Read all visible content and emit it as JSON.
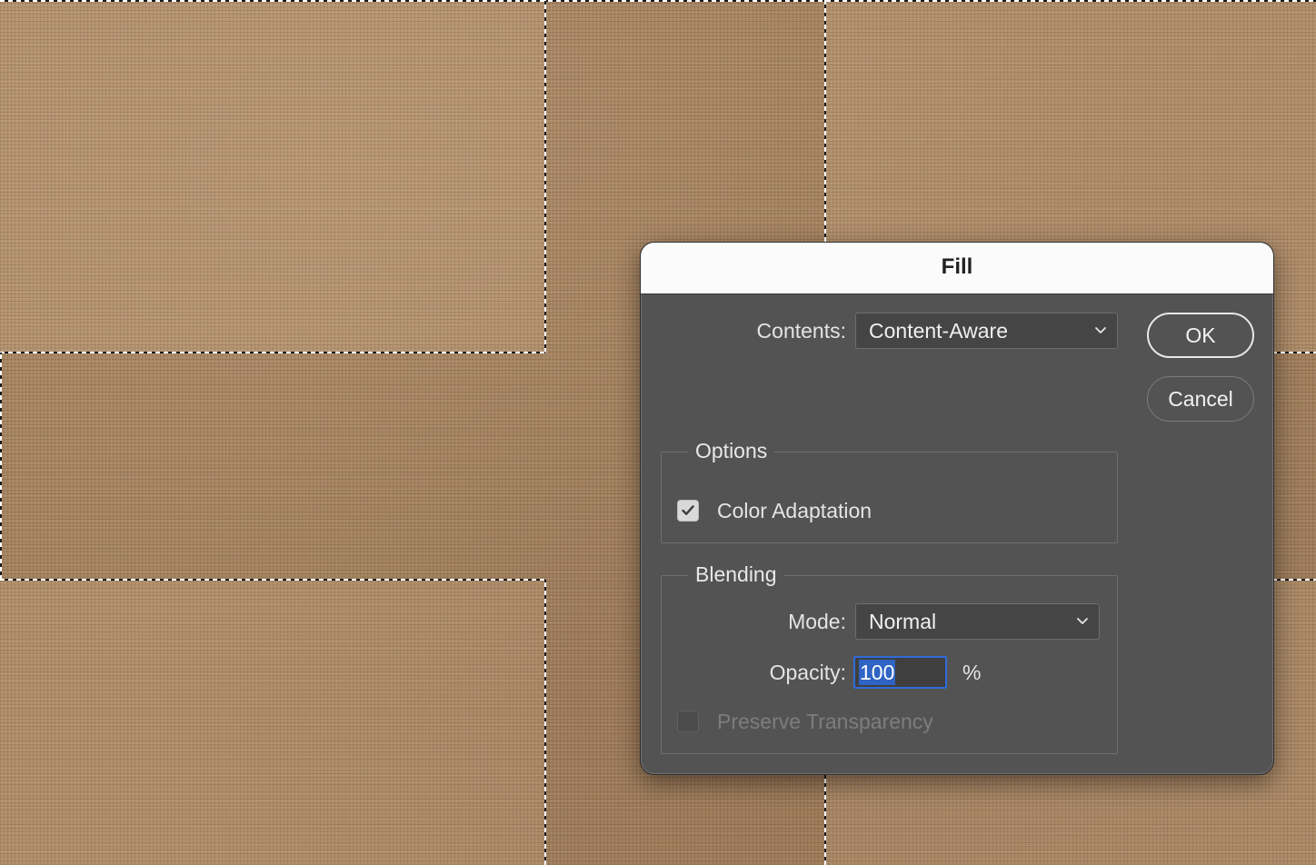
{
  "dialog": {
    "title": "Fill",
    "contents": {
      "label": "Contents:",
      "selected": "Content-Aware"
    },
    "buttons": {
      "ok": "OK",
      "cancel": "Cancel"
    },
    "options": {
      "legend": "Options",
      "color_adaptation": {
        "label": "Color Adaptation",
        "checked": true
      }
    },
    "blending": {
      "legend": "Blending",
      "mode": {
        "label": "Mode:",
        "selected": "Normal"
      },
      "opacity": {
        "label": "Opacity:",
        "value": "100",
        "unit": "%"
      },
      "preserve_transparency": {
        "label": "Preserve Transparency",
        "checked": false,
        "enabled": false
      }
    }
  },
  "icons": {
    "dropdown": "chevron-down-icon",
    "check": "checkmark-icon"
  },
  "colors": {
    "dialog_bg": "#535353",
    "titlebar_bg": "#fbfbfb",
    "focus_accent": "#2f6bd8",
    "canvas_base": "#ae8c69"
  }
}
